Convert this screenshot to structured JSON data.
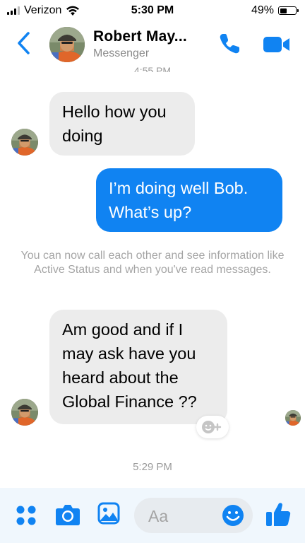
{
  "status_bar": {
    "carrier": "Verizon",
    "time": "5:30 PM",
    "battery": "49%",
    "battery_level": 0.49
  },
  "header": {
    "contact_name": "Robert May...",
    "subtitle": "Messenger",
    "clipped_time": "4:55 PM"
  },
  "messages": [
    {
      "direction": "incoming",
      "text": "Hello how you doing"
    },
    {
      "direction": "outgoing",
      "text": "I’m doing well Bob. What’s up?"
    },
    {
      "direction": "incoming",
      "text": "Am good and if I may ask have you heard about the Global Finance ??"
    }
  ],
  "system_note": "You can now call each other and see information like Active Status and when you've read messages.",
  "time_separator": "5:29 PM",
  "composer": {
    "placeholder": "Aa"
  },
  "colors": {
    "accent": "#1083f2",
    "incoming_bubble": "#ececec",
    "meta_text": "#9a9a9a"
  },
  "icons": [
    "back-chevron-icon",
    "phone-icon",
    "video-camera-icon",
    "apps-grid-icon",
    "camera-icon",
    "gallery-icon",
    "emoji-icon",
    "thumbs-up-icon",
    "add-reaction-icon"
  ]
}
